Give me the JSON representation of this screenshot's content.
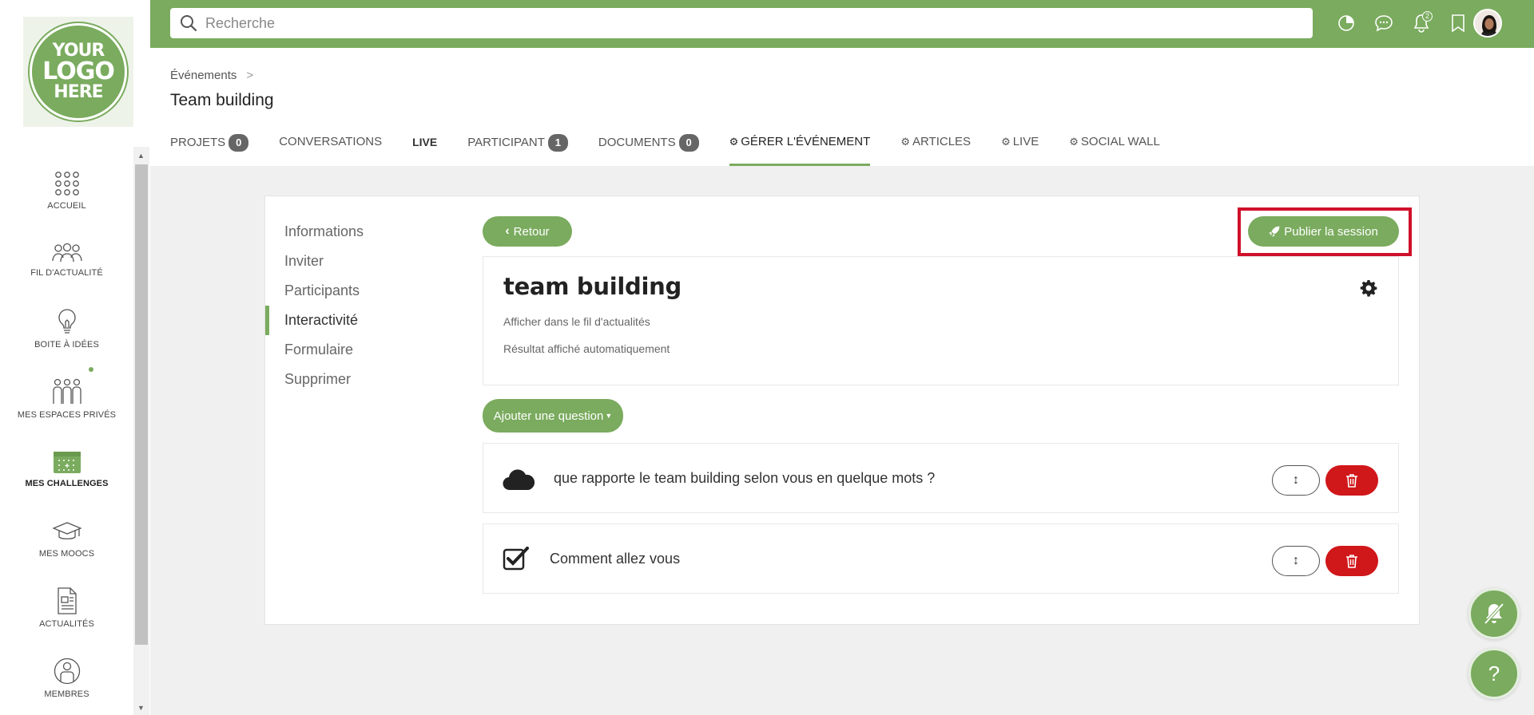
{
  "logo": {
    "line1": "YOUR",
    "line2": "LOGO",
    "line3": "HERE"
  },
  "sidebar": {
    "items": [
      {
        "label": "ACCUEIL",
        "icon": "grid-dots-icon"
      },
      {
        "label": "FIL D'ACTUALITÉ",
        "icon": "people-group-icon"
      },
      {
        "label": "BOITE À IDÉES",
        "icon": "lightbulb-icon"
      },
      {
        "label": "MES ESPACES PRIVÉS",
        "icon": "users-icon"
      },
      {
        "label": "MES CHALLENGES",
        "icon": "calendar-icon"
      },
      {
        "label": "MES MOOCS",
        "icon": "graduation-cap-icon"
      },
      {
        "label": "ACTUALITÉS",
        "icon": "news-icon"
      },
      {
        "label": "MEMBRES",
        "icon": "member-icon"
      }
    ],
    "active": "MES CHALLENGES"
  },
  "topbar": {
    "search_placeholder": "Recherche",
    "notifications_count": "2"
  },
  "breadcrumb": {
    "parent": "Événements"
  },
  "page_title": "Team building",
  "tabs": [
    {
      "label": "PROJETS",
      "count": "0"
    },
    {
      "label": "CONVERSATIONS"
    },
    {
      "label": "LIVE"
    },
    {
      "label": "PARTICIPANT",
      "count": "1"
    },
    {
      "label": "DOCUMENTS",
      "count": "0"
    },
    {
      "label": "GÉRER L'ÉVÉNEMENT"
    },
    {
      "label": "ARTICLES"
    },
    {
      "label": "LIVE"
    },
    {
      "label": "SOCIAL WALL"
    }
  ],
  "submenu": [
    "Informations",
    "Inviter",
    "Participants",
    "Interactivité",
    "Formulaire",
    "Supprimer"
  ],
  "buttons": {
    "retour": "Retour",
    "publier": "Publier la session",
    "ajouter": "Ajouter une question"
  },
  "session": {
    "title": "team building",
    "line1": "Afficher dans le fil d'actualités",
    "line2": "Résultat affiché automatiquement"
  },
  "questions": [
    {
      "text": "que rapporte le team building selon vous en quelque mots ?",
      "icon": "cloud-icon"
    },
    {
      "text": "Comment allez vous",
      "icon": "checkbox-icon"
    }
  ],
  "colors": {
    "accent": "#7aab5e",
    "danger": "#d0171a",
    "highlight": "#d0102a"
  },
  "help_label": "?"
}
